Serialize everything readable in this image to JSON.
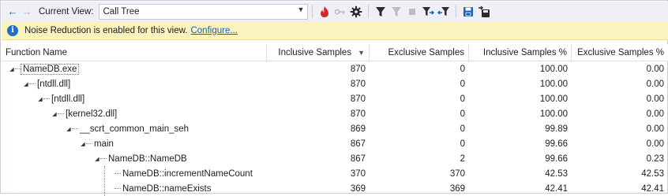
{
  "toolbar": {
    "current_view_label": "Current View:",
    "current_view_value": "Call Tree",
    "back_icon": "arrow-left-icon",
    "forward_icon": "arrow-right-icon",
    "icons": [
      "flame-icon",
      "key-icon",
      "gear-icon",
      "filter-icon",
      "clear-filter-icon",
      "stop-icon",
      "filter-caller-icon",
      "filter-callee-icon",
      "save-icon",
      "export-icon"
    ]
  },
  "banner": {
    "text": "Noise Reduction is enabled for this view.",
    "link": "Configure..."
  },
  "table": {
    "columns": [
      "Function Name",
      "Inclusive Samples",
      "Exclusive Samples",
      "Inclusive Samples %",
      "Exclusive Samples %"
    ],
    "sort_column": "Inclusive Samples",
    "sort_direction": "descending",
    "rows": [
      {
        "name": "NameDB.exe",
        "depth": 0,
        "expanded": true,
        "inclusive": "870",
        "exclusive": "0",
        "inclusive_pct": "100.00",
        "exclusive_pct": "0.00"
      },
      {
        "name": "[ntdll.dll]",
        "depth": 1,
        "expanded": true,
        "inclusive": "870",
        "exclusive": "0",
        "inclusive_pct": "100.00",
        "exclusive_pct": "0.00"
      },
      {
        "name": "[ntdll.dll]",
        "depth": 2,
        "expanded": true,
        "inclusive": "870",
        "exclusive": "0",
        "inclusive_pct": "100.00",
        "exclusive_pct": "0.00"
      },
      {
        "name": "[kernel32.dll]",
        "depth": 3,
        "expanded": true,
        "inclusive": "870",
        "exclusive": "0",
        "inclusive_pct": "100.00",
        "exclusive_pct": "0.00"
      },
      {
        "name": "__scrt_common_main_seh",
        "depth": 4,
        "expanded": true,
        "inclusive": "869",
        "exclusive": "0",
        "inclusive_pct": "99.89",
        "exclusive_pct": "0.00"
      },
      {
        "name": "main",
        "depth": 5,
        "expanded": true,
        "inclusive": "867",
        "exclusive": "0",
        "inclusive_pct": "99.66",
        "exclusive_pct": "0.00"
      },
      {
        "name": "NameDB::NameDB",
        "depth": 6,
        "expanded": true,
        "inclusive": "867",
        "exclusive": "2",
        "inclusive_pct": "99.66",
        "exclusive_pct": "0.23"
      },
      {
        "name": "NameDB::incrementNameCount",
        "depth": 7,
        "expanded": false,
        "inclusive": "370",
        "exclusive": "370",
        "inclusive_pct": "42.53",
        "exclusive_pct": "42.53"
      },
      {
        "name": "NameDB::nameExists",
        "depth": 7,
        "expanded": false,
        "inclusive": "369",
        "exclusive": "369",
        "inclusive_pct": "42.41",
        "exclusive_pct": "42.41"
      }
    ]
  }
}
